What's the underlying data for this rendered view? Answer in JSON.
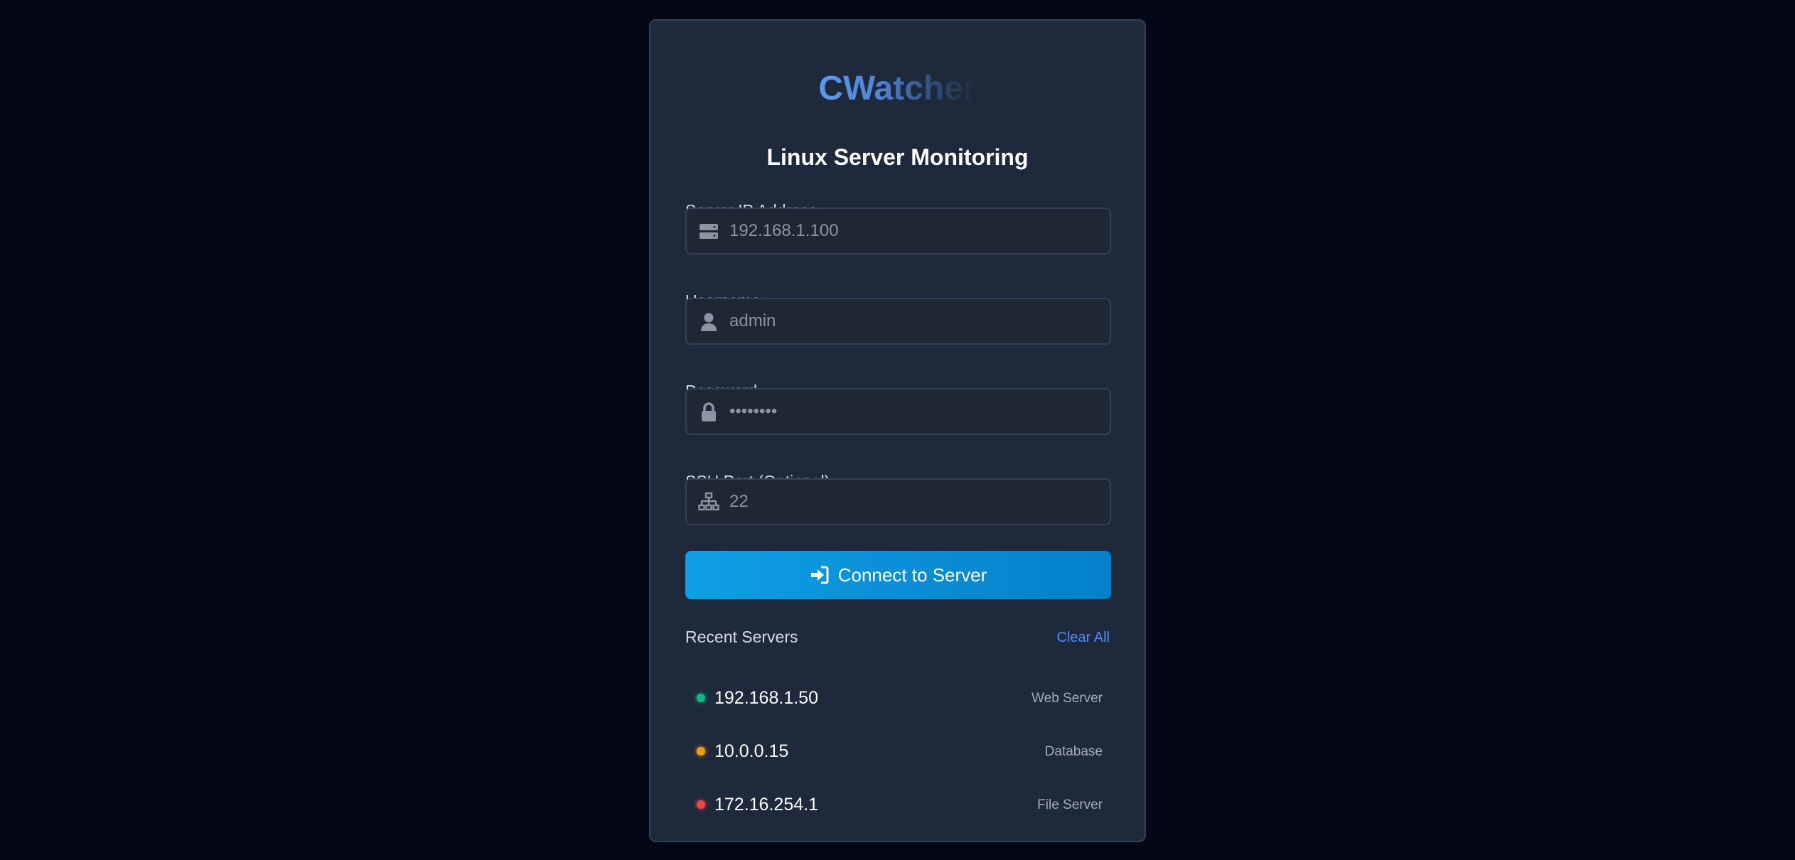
{
  "app": {
    "logo": "CWatcher",
    "subtitle": "Linux Server Monitoring"
  },
  "form": {
    "ip": {
      "label": "Server IP Address",
      "placeholder": "192.168.1.100",
      "icon": "server-icon"
    },
    "username": {
      "label": "Username",
      "placeholder": "admin",
      "icon": "user-icon"
    },
    "password": {
      "label": "Password",
      "placeholder": "••••••••",
      "icon": "lock-icon"
    },
    "port": {
      "label": "SSH Port (Optional)",
      "placeholder": "22",
      "icon": "network-icon"
    },
    "connect_label": "Connect to Server",
    "connect_icon": "sign-in-icon"
  },
  "recent": {
    "title": "Recent Servers",
    "clear_label": "Clear All",
    "servers": [
      {
        "ip": "192.168.1.50",
        "name": "Web Server",
        "status_color": "#10b981"
      },
      {
        "ip": "10.0.0.15",
        "name": "Database",
        "status_color": "#f59e0b"
      },
      {
        "ip": "172.16.254.1",
        "name": "File Server",
        "status_color": "#ef4444"
      }
    ]
  },
  "colors": {
    "background": "#040816",
    "card": "#1e293b",
    "accent": "#0ea5e9",
    "link": "#4f8ef7"
  }
}
